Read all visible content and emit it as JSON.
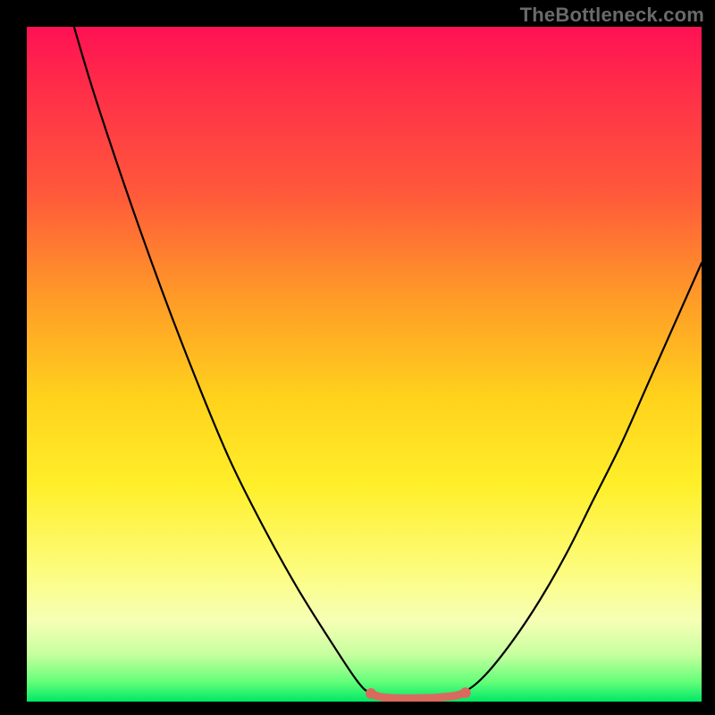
{
  "watermark_text": "TheBottleneck.com",
  "chart_data": {
    "type": "line",
    "title": "",
    "xlabel": "",
    "ylabel": "",
    "xlim": [
      0,
      100
    ],
    "ylim": [
      0,
      100
    ],
    "grid": false,
    "legend": false,
    "series": [
      {
        "name": "left-curve",
        "x": [
          7,
          10,
          15,
          20,
          25,
          30,
          35,
          40,
          45,
          49,
          51,
          53
        ],
        "values": [
          100,
          90,
          75,
          61,
          48,
          36,
          26,
          17,
          9,
          3,
          1.2,
          0.8
        ]
      },
      {
        "name": "right-curve",
        "x": [
          63,
          65,
          68,
          72,
          76,
          80,
          84,
          88,
          92,
          96,
          100
        ],
        "values": [
          0.8,
          1.5,
          4,
          9,
          15,
          22,
          30,
          38,
          47,
          56,
          65
        ]
      },
      {
        "name": "bottom-highlight",
        "x": [
          51,
          52,
          53,
          55,
          58,
          61,
          63,
          64,
          65
        ],
        "values": [
          1.2,
          0.8,
          0.6,
          0.5,
          0.5,
          0.6,
          0.8,
          1.0,
          1.3
        ]
      }
    ],
    "colors": {
      "curve": "#000000",
      "highlight": "#d96a5e"
    },
    "background_gradient_stops": [
      {
        "pos": 0,
        "color": "#ff1154"
      },
      {
        "pos": 0.25,
        "color": "#ff5a3a"
      },
      {
        "pos": 0.55,
        "color": "#ffd21c"
      },
      {
        "pos": 0.8,
        "color": "#fdfc7a"
      },
      {
        "pos": 0.97,
        "color": "#66ff7a"
      },
      {
        "pos": 1.0,
        "color": "#00e865"
      }
    ]
  }
}
